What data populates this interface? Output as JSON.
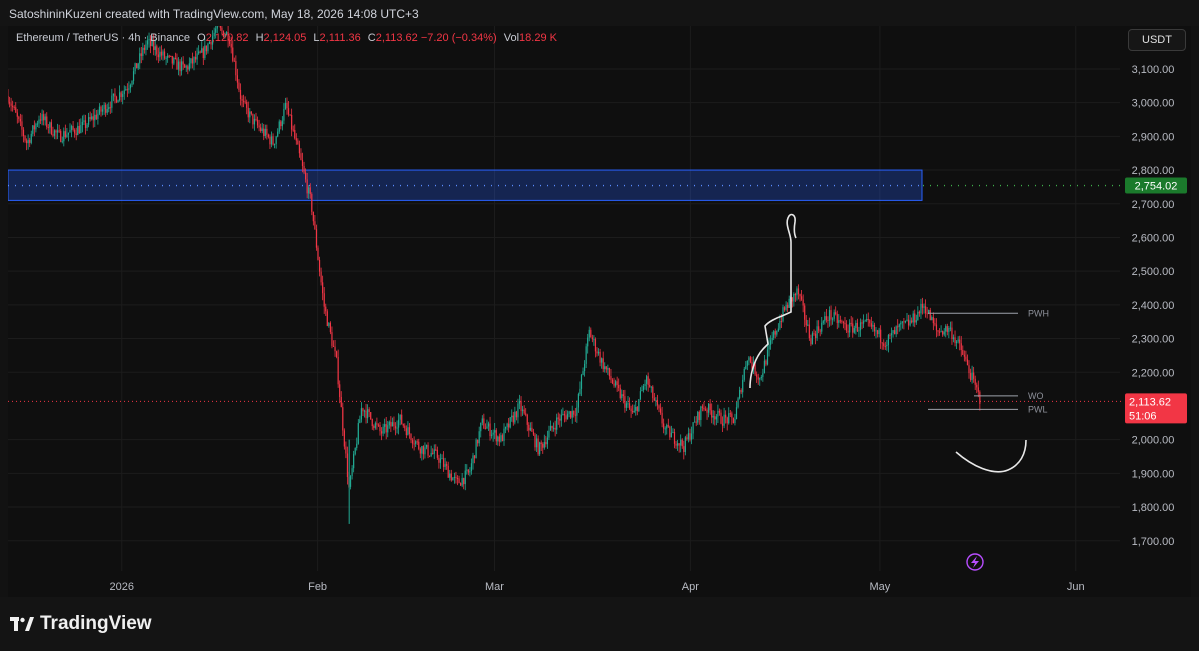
{
  "header": {
    "credit": "SatoshininKuzeni created with TradingView.com, May 18, 2026 14:08 UTC+3"
  },
  "legend": {
    "symbol": "Ethereum / TetherUS · 4h · Binance",
    "open_label": "O",
    "open": "2,120.82",
    "high_label": "H",
    "high": "2,124.05",
    "low_label": "L",
    "low": "2,111.36",
    "close_label": "C",
    "close": "2,113.62",
    "change": "−7.20 (−0.34%)",
    "vol_label": "Vol",
    "vol": "18.29 K"
  },
  "currency": "USDT",
  "price_scale": [
    "3,100.00",
    "3,000.00",
    "2,900.00",
    "2,800.00",
    "2,700.00",
    "2,600.00",
    "2,500.00",
    "2,400.00",
    "2,300.00",
    "2,200.00",
    "2,000.00",
    "1,900.00",
    "1,800.00",
    "1,700.00"
  ],
  "time_axis": [
    "2026",
    "Feb",
    "Mar",
    "Apr",
    "May",
    "Jun"
  ],
  "badges": {
    "zone_price": "2,754.02",
    "last_price": "2,113.62",
    "countdown": "51:06"
  },
  "annotations": {
    "pwh": "PWH",
    "wo": "WO",
    "pwl": "PWL"
  },
  "footer": {
    "logo_text": "TradingView"
  },
  "colors": {
    "up": "#22ab94",
    "down": "#f23645",
    "zone": "#2962ff",
    "background": "#0f0f0f"
  },
  "chart_data": {
    "type": "candlestick",
    "symbol": "ETH/USDT",
    "interval": "4h",
    "ylim": [
      1650,
      3180
    ],
    "x_range": [
      "2025-12-14",
      "2026-06-08"
    ],
    "x_ticks": [
      {
        "label": "2026",
        "date": "2026-01-01"
      },
      {
        "label": "Feb",
        "date": "2026-02-01"
      },
      {
        "label": "Mar",
        "date": "2026-03-01"
      },
      {
        "label": "Apr",
        "date": "2026-04-01"
      },
      {
        "label": "May",
        "date": "2026-05-01"
      },
      {
        "label": "Jun",
        "date": "2026-06-01"
      }
    ],
    "series_approx_close": [
      {
        "date": "2025-12-14",
        "close": 3020
      },
      {
        "date": "2025-12-17",
        "close": 2880
      },
      {
        "date": "2025-12-19",
        "close": 2960
      },
      {
        "date": "2025-12-22",
        "close": 2900
      },
      {
        "date": "2025-12-26",
        "close": 2930
      },
      {
        "date": "2025-12-29",
        "close": 2980
      },
      {
        "date": "2026-01-02",
        "close": 3050
      },
      {
        "date": "2026-01-05",
        "close": 3180
      },
      {
        "date": "2026-01-08",
        "close": 3130
      },
      {
        "date": "2026-01-11",
        "close": 3100
      },
      {
        "date": "2026-01-14",
        "close": 3150
      },
      {
        "date": "2026-01-16",
        "close": 3220
      },
      {
        "date": "2026-01-18",
        "close": 3200
      },
      {
        "date": "2026-01-20",
        "close": 3000
      },
      {
        "date": "2026-01-22",
        "close": 2940
      },
      {
        "date": "2026-01-25",
        "close": 2880
      },
      {
        "date": "2026-01-27",
        "close": 2990
      },
      {
        "date": "2026-01-29",
        "close": 2850
      },
      {
        "date": "2026-01-31",
        "close": 2700
      },
      {
        "date": "2026-02-02",
        "close": 2400
      },
      {
        "date": "2026-02-04",
        "close": 2230
      },
      {
        "date": "2026-02-06",
        "close": 1850
      },
      {
        "date": "2026-02-08",
        "close": 2100
      },
      {
        "date": "2026-02-11",
        "close": 2020
      },
      {
        "date": "2026-02-14",
        "close": 2060
      },
      {
        "date": "2026-02-17",
        "close": 1980
      },
      {
        "date": "2026-02-20",
        "close": 1950
      },
      {
        "date": "2026-02-23",
        "close": 1870
      },
      {
        "date": "2026-02-25",
        "close": 1900
      },
      {
        "date": "2026-02-27",
        "close": 2050
      },
      {
        "date": "2026-03-02",
        "close": 2000
      },
      {
        "date": "2026-03-05",
        "close": 2100
      },
      {
        "date": "2026-03-08",
        "close": 1970
      },
      {
        "date": "2026-03-11",
        "close": 2060
      },
      {
        "date": "2026-03-14",
        "close": 2090
      },
      {
        "date": "2026-03-16",
        "close": 2320
      },
      {
        "date": "2026-03-18",
        "close": 2230
      },
      {
        "date": "2026-03-20",
        "close": 2160
      },
      {
        "date": "2026-03-23",
        "close": 2070
      },
      {
        "date": "2026-03-25",
        "close": 2180
      },
      {
        "date": "2026-03-28",
        "close": 2030
      },
      {
        "date": "2026-03-31",
        "close": 1980
      },
      {
        "date": "2026-04-03",
        "close": 2100
      },
      {
        "date": "2026-04-06",
        "close": 2060
      },
      {
        "date": "2026-04-08",
        "close": 2060
      },
      {
        "date": "2026-04-10",
        "close": 2250
      },
      {
        "date": "2026-04-12",
        "close": 2180
      },
      {
        "date": "2026-04-14",
        "close": 2300
      },
      {
        "date": "2026-04-16",
        "close": 2390
      },
      {
        "date": "2026-04-18",
        "close": 2440
      },
      {
        "date": "2026-04-20",
        "close": 2300
      },
      {
        "date": "2026-04-23",
        "close": 2370
      },
      {
        "date": "2026-04-26",
        "close": 2330
      },
      {
        "date": "2026-04-29",
        "close": 2340
      },
      {
        "date": "2026-05-02",
        "close": 2290
      },
      {
        "date": "2026-05-04",
        "close": 2330
      },
      {
        "date": "2026-05-06",
        "close": 2350
      },
      {
        "date": "2026-05-08",
        "close": 2400
      },
      {
        "date": "2026-05-10",
        "close": 2320
      },
      {
        "date": "2026-05-12",
        "close": 2330
      },
      {
        "date": "2026-05-14",
        "close": 2260
      },
      {
        "date": "2026-05-16",
        "close": 2160
      },
      {
        "date": "2026-05-17",
        "close": 2114
      }
    ],
    "levels": {
      "supply_zone": [
        2710,
        2800
      ],
      "zone_line": 2754.02,
      "last_price": 2113.62,
      "PWH": 2375,
      "WO": 2130,
      "PWL": 2090
    }
  }
}
